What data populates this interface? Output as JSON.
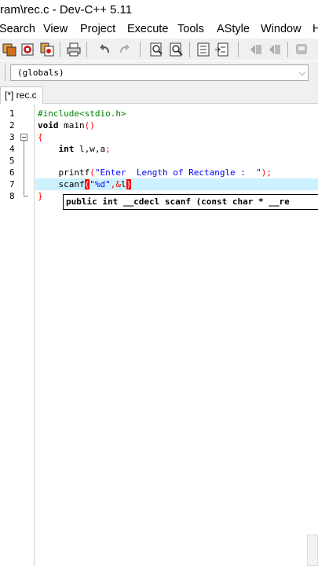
{
  "window": {
    "title": "ram\\rec.c - Dev-C++ 5.11"
  },
  "menu": {
    "items": [
      "Search",
      "View",
      "Project",
      "Execute",
      "Tools",
      "AStyle",
      "Window",
      "H"
    ]
  },
  "toolbar": {
    "icons": [
      "compile-icon",
      "run-icon",
      "compile-run-icon",
      "print-icon",
      "undo-icon",
      "redo-icon",
      "find-icon",
      "replace-icon",
      "indent-icon",
      "unindent-icon",
      "goto-back-icon",
      "goto-forward-icon",
      "bookmark-icon"
    ]
  },
  "scope_selector": {
    "value": "(globals)",
    "arrow": "⌵"
  },
  "tabs": [
    {
      "label": "[*] rec.c",
      "active": true
    }
  ],
  "editor": {
    "line_numbers": [
      "1",
      "2",
      "3",
      "4",
      "5",
      "6",
      "7",
      "8"
    ],
    "current_line": 7,
    "lines": {
      "l1": "#include<stdio.h>",
      "l2_kw": "void",
      "l2_rest": " main",
      "l2_paren": "()",
      "l3": "{",
      "l4_kw": "int",
      "l4_rest": " l,w,a",
      "l4_semi": ";",
      "l6_fn": "printf",
      "l6_open": "(",
      "l6_str": "\"Enter  Length of Rectangle :  \"",
      "l6_close": ");",
      "l7_fn": "scanf",
      "l7_open": "(",
      "l7_str": "\"%d\"",
      "l7_comma": ",",
      "l7_amp": "&",
      "l7_var": "l",
      "l7_close": ")",
      "l8": "}"
    }
  },
  "tooltip": {
    "text": "public int __cdecl scanf (const char * __re"
  }
}
